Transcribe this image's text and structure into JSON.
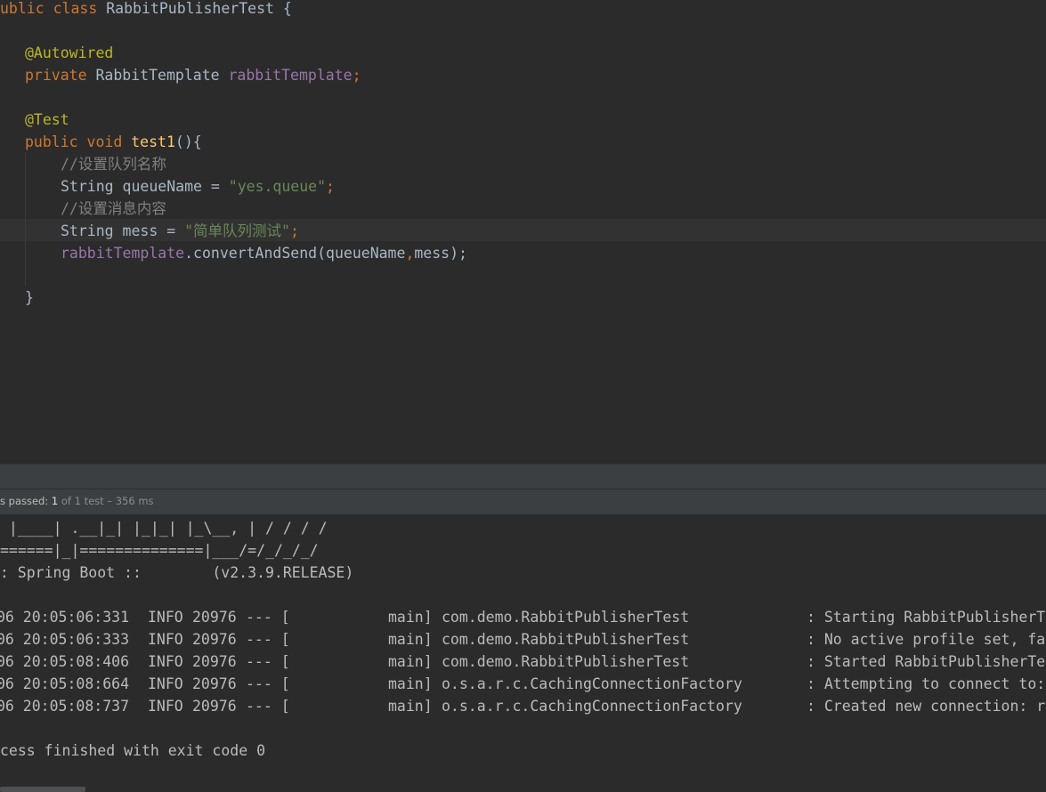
{
  "editor": {
    "class_decl": {
      "prefix": "ublic",
      "kw_class": "class",
      "name": "RabbitPublisherTest",
      "brace": "{"
    },
    "annotation_autowired": "@Autowired",
    "field_decl": {
      "kw_private": "private",
      "type": "RabbitTemplate",
      "name": "rabbitTemplate",
      "semi": ";"
    },
    "annotation_test": "@Test",
    "method_decl": {
      "kw_public": "public",
      "kw_void": "void",
      "name": "test1",
      "rest": "(){"
    },
    "comment1": "//设置队列名称",
    "queue_decl": {
      "type": "String",
      "name": "queueName",
      "eq": "=",
      "value": "\"yes.queue\"",
      "semi": ";"
    },
    "comment2": "//设置消息内容",
    "mess_decl": {
      "type": "String",
      "name": "mess",
      "eq": "=",
      "value": "\"简单队列测试\"",
      "semi": ";"
    },
    "send_call": {
      "obj": "rabbitTemplate",
      "method": ".convertAndSend(queueName",
      "comma": ",",
      "arg": "mess);"
    },
    "close_brace": "}"
  },
  "status": {
    "passed_prefix": "s passed: ",
    "passed_count": "1",
    "detail": " of 1 test – 356 ms"
  },
  "console": {
    "banner_line1": " |____| .__|_| |_|_| |_\\__, | / / / /",
    "banner_line2": "======|_|==============|___/=/_/_/_/",
    "banner_line3": ":: Spring Boot ::        (v2.3.9.RELEASE)",
    "log_lines": [
      {
        "time": "06 20:05:06:331",
        "level": "INFO",
        "pid": "20976",
        "sep": "--- [",
        "thread": "main]",
        "logger": "com.demo.RabbitPublisherTest",
        "message": ": Starting RabbitPublisherT"
      },
      {
        "time": "06 20:05:06:333",
        "level": "INFO",
        "pid": "20976",
        "sep": "--- [",
        "thread": "main]",
        "logger": "com.demo.RabbitPublisherTest",
        "message": ": No active profile set, fa"
      },
      {
        "time": "06 20:05:08:406",
        "level": "INFO",
        "pid": "20976",
        "sep": "--- [",
        "thread": "main]",
        "logger": "com.demo.RabbitPublisherTest",
        "message": ": Started RabbitPublisherTe"
      },
      {
        "time": "06 20:05:08:664",
        "level": "INFO",
        "pid": "20976",
        "sep": "--- [",
        "thread": "main]",
        "logger": "o.s.a.r.c.CachingConnectionFactory",
        "message": ": Attempting to connect to:"
      },
      {
        "time": "06 20:05:08:737",
        "level": "INFO",
        "pid": "20976",
        "sep": "--- [",
        "thread": "main]",
        "logger": "o.s.a.r.c.CachingConnectionFactory",
        "message": ": Created new connection: r"
      }
    ],
    "exit_line": "cess finished with exit code 0"
  }
}
